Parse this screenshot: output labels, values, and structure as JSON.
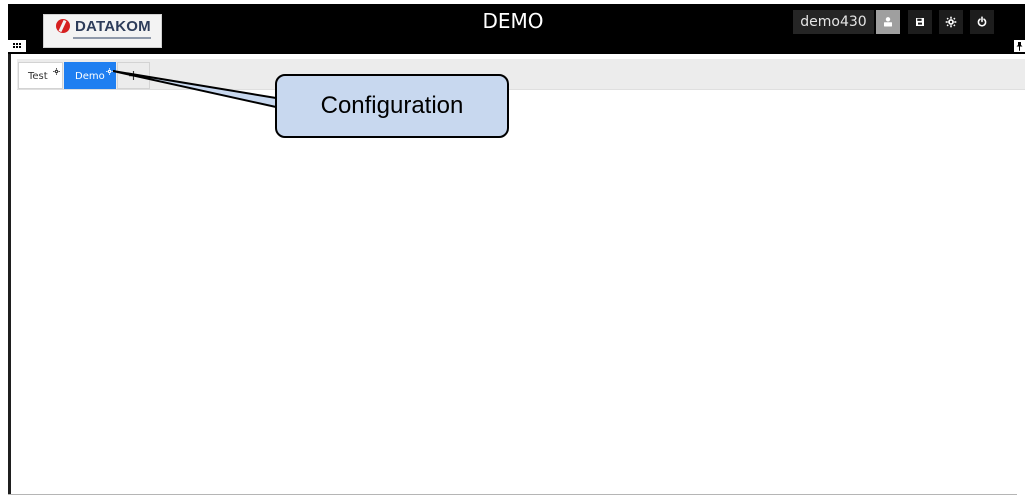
{
  "header": {
    "title": "DEMO",
    "brand": "DATAKOM",
    "user": "demo430"
  },
  "tabs": [
    {
      "label": "Test"
    },
    {
      "label": "Demo"
    },
    {
      "label": "+"
    }
  ],
  "annotation": {
    "label": "Configuration"
  },
  "icons": {
    "grid": "grid-icon",
    "user": "user-icon",
    "save": "save-icon",
    "settings": "settings-icon",
    "power": "power-icon",
    "pin": "pin-icon",
    "gear": "gear-icon"
  },
  "colors": {
    "header_bg": "#000000",
    "tab_active": "#1f7ff1",
    "tab_strip": "#ececec",
    "callout_fill": "#c8d8ef",
    "brand_red": "#d62020",
    "brand_text": "#2d3c5a"
  }
}
